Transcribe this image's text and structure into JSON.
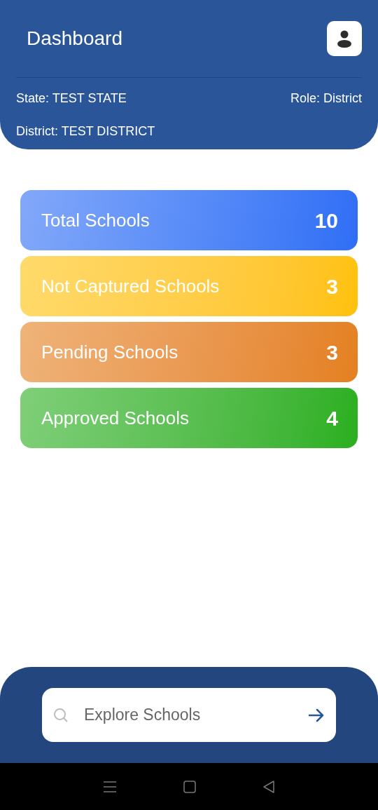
{
  "header": {
    "title": "Dashboard",
    "state": "State: TEST STATE",
    "role": "Role: District",
    "district": "District: TEST DISTRICT"
  },
  "cards": [
    {
      "label": "Total Schools",
      "count": "10",
      "color": "#2f6ef5"
    },
    {
      "label": "Not Captured Schools",
      "count": "3",
      "color": "#ffc107"
    },
    {
      "label": "Pending Schools",
      "count": "3",
      "color": "#e4801f"
    },
    {
      "label": "Approved Schools",
      "count": "4",
      "color": "#2aaf1e"
    }
  ],
  "search": {
    "placeholder": "Explore Schools"
  }
}
